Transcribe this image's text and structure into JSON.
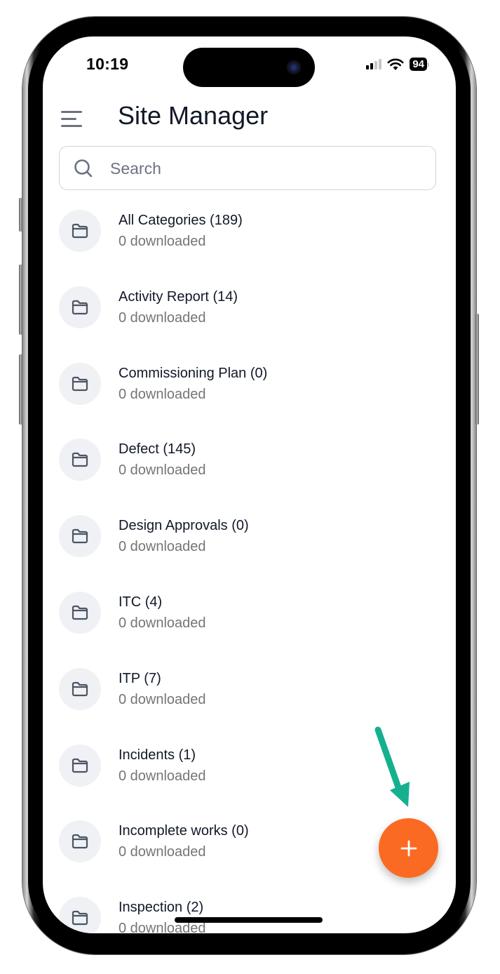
{
  "status_bar": {
    "time": "10:19",
    "battery": "94",
    "signal_bars_active": 2,
    "signal_bars_total": 4
  },
  "header": {
    "menu_icon": "hamburger-menu-icon",
    "title": "Site Manager"
  },
  "search": {
    "placeholder": "Search",
    "value": "",
    "icon": "search-icon"
  },
  "categories": [
    {
      "title": "All Categories (189)",
      "subtitle": "0 downloaded",
      "icon": "folder-icon"
    },
    {
      "title": "Activity Report (14)",
      "subtitle": "0 downloaded",
      "icon": "folder-icon"
    },
    {
      "title": "Commissioning Plan (0)",
      "subtitle": "0 downloaded",
      "icon": "folder-icon"
    },
    {
      "title": "Defect (145)",
      "subtitle": "0 downloaded",
      "icon": "folder-icon"
    },
    {
      "title": "Design Approvals (0)",
      "subtitle": "0 downloaded",
      "icon": "folder-icon"
    },
    {
      "title": "ITC (4)",
      "subtitle": "0 downloaded",
      "icon": "folder-icon"
    },
    {
      "title": "ITP (7)",
      "subtitle": "0 downloaded",
      "icon": "folder-icon"
    },
    {
      "title": "Incidents (1)",
      "subtitle": "0 downloaded",
      "icon": "folder-icon"
    },
    {
      "title": "Incomplete works (0)",
      "subtitle": "0 downloaded",
      "icon": "folder-icon"
    },
    {
      "title": "Inspection (2)",
      "subtitle": "0 downloaded",
      "icon": "folder-icon"
    }
  ],
  "fab": {
    "icon": "plus-icon",
    "color": "#fb6a22"
  },
  "annotation": {
    "icon": "arrow-pointer-icon",
    "color": "#16b08f"
  },
  "colors": {
    "title_text": "#111827",
    "subtitle_text": "#757575",
    "folder_bg": "#f0f1f5",
    "folder_stroke": "#4b5563"
  }
}
